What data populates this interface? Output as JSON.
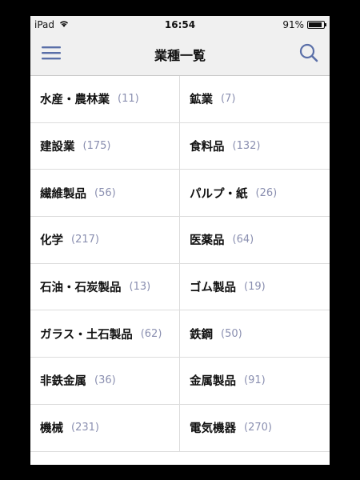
{
  "status_bar": {
    "device": "iPad",
    "time": "16:54",
    "battery": "91%",
    "battery_level": 0.91
  },
  "nav": {
    "title": "業種一覧"
  },
  "industries": [
    {
      "name": "水産・農林業",
      "count": "(11)"
    },
    {
      "name": "鉱業",
      "count": "(7)"
    },
    {
      "name": "建設業",
      "count": "(175)"
    },
    {
      "name": "食料品",
      "count": "(132)"
    },
    {
      "name": "繊維製品",
      "count": "(56)"
    },
    {
      "name": "パルプ・紙",
      "count": "(26)"
    },
    {
      "name": "化学",
      "count": "(217)"
    },
    {
      "name": "医薬品",
      "count": "(64)"
    },
    {
      "name": "石油・石炭製品",
      "count": "(13)"
    },
    {
      "name": "ゴム製品",
      "count": "(19)"
    },
    {
      "name": "ガラス・土石製品",
      "count": "(62)"
    },
    {
      "name": "鉄鋼",
      "count": "(50)"
    },
    {
      "name": "非鉄金属",
      "count": "(36)"
    },
    {
      "name": "金属製品",
      "count": "(91)"
    },
    {
      "name": "機械",
      "count": "(231)"
    },
    {
      "name": "電気機器",
      "count": "(270)"
    }
  ],
  "colors": {
    "accent": "#5a6fa8",
    "count_text": "#8a8fb0"
  }
}
